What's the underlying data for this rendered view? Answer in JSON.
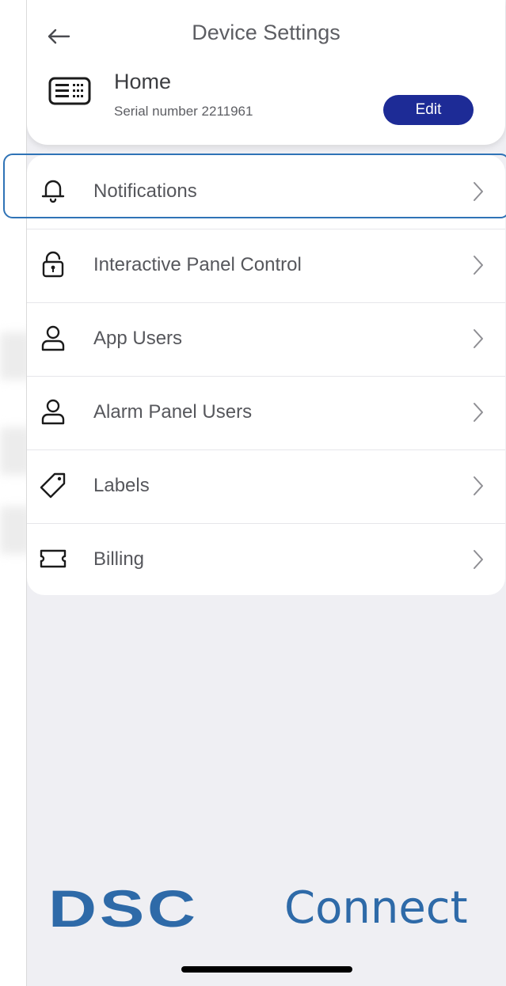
{
  "header": {
    "title": "Device Settings",
    "device_name": "Home",
    "serial": "Serial number 2211961",
    "edit_label": "Edit",
    "back_icon": "arrow-left-icon",
    "device_icon": "keypad-panel-icon"
  },
  "menu": {
    "items": [
      {
        "label": "Notifications",
        "icon": "bell-icon",
        "selected": true
      },
      {
        "label": "Interactive Panel Control",
        "icon": "lock-icon"
      },
      {
        "label": "App Users",
        "icon": "user-icon"
      },
      {
        "label": "Alarm Panel Users",
        "icon": "user-icon"
      },
      {
        "label": "Labels",
        "icon": "tag-icon"
      },
      {
        "label": "Billing",
        "icon": "ticket-icon"
      }
    ]
  },
  "brand": {
    "part1": "DSC",
    "part2": "Connect"
  },
  "colors": {
    "accent": "#1d2b96",
    "brand": "#2e6aa8",
    "highlight": "#2f73b6",
    "background": "#efeff3"
  }
}
